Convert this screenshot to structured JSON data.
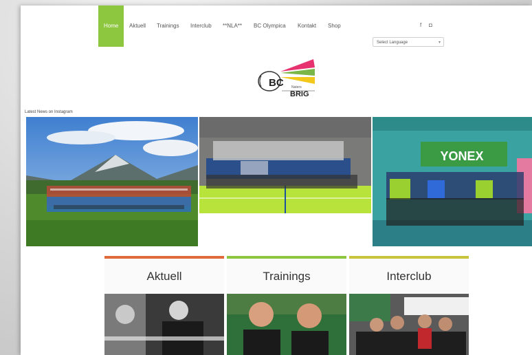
{
  "nav": {
    "items": [
      {
        "label": "Home",
        "active": true
      },
      {
        "label": "Aktuell"
      },
      {
        "label": "Trainings"
      },
      {
        "label": "Interclub"
      },
      {
        "label": "**NLA**"
      },
      {
        "label": "BC Olympica"
      },
      {
        "label": "Kontakt"
      },
      {
        "label": "Shop"
      }
    ],
    "social": [
      {
        "icon": "facebook-icon",
        "glyph": "f"
      },
      {
        "icon": "instagram-icon",
        "glyph": "◘"
      }
    ],
    "language_select": "Select Language"
  },
  "logo": {
    "line1": "BC",
    "line2": "BRIG",
    "tag": "Naters"
  },
  "instagram_label": "Latest News on Instagram",
  "cards": [
    {
      "title": "Aktuell",
      "color": "#e06a3c"
    },
    {
      "title": "Trainings",
      "color": "#8dc63f"
    },
    {
      "title": "Interclub",
      "color": "#c9c43c"
    }
  ],
  "colors": {
    "accent": "#8dc63f",
    "logo_pink": "#e6336f",
    "logo_green": "#7ab648",
    "logo_yellow": "#f2c81c"
  },
  "photo3_banner": "YONEX"
}
